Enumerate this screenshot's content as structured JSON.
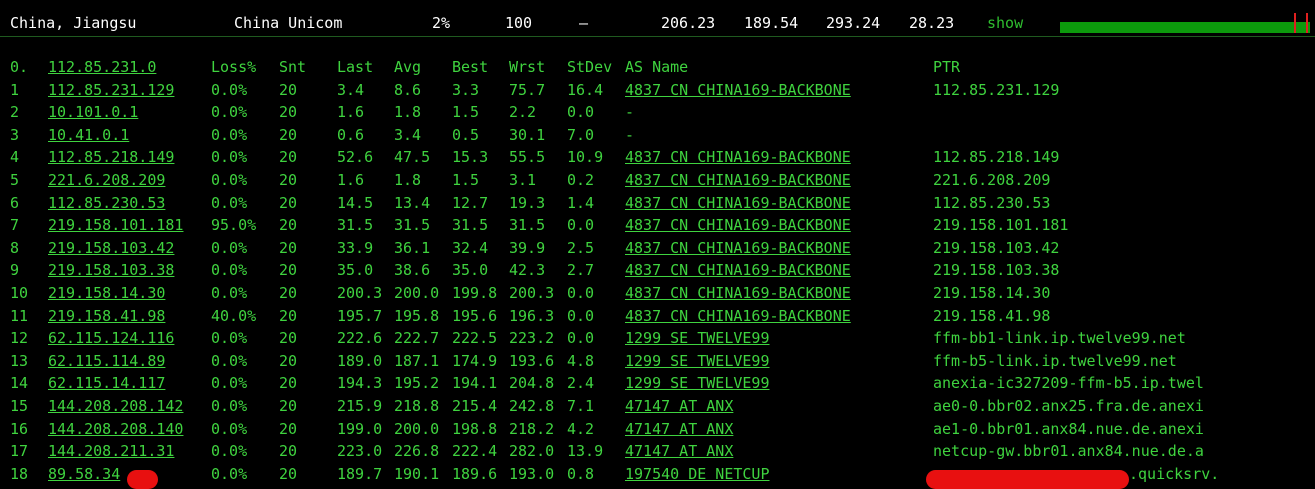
{
  "summary": {
    "location": "China, Jiangsu",
    "isp": "China Unicom",
    "loss": "2%",
    "sent": "100",
    "dash": "–",
    "last": "206.23",
    "best": "189.54",
    "worst": "293.24",
    "stdev": "28.23",
    "show_label": "show",
    "graph_color": "#0c9a0c",
    "graph_marker_color": "#e02020"
  },
  "table": {
    "headers": {
      "no": "0.",
      "host": "112.85.231.0",
      "loss": "Loss%",
      "snt": "Snt",
      "last": "Last",
      "avg": "Avg",
      "best": "Best",
      "wrst": "Wrst",
      "stdev": "StDev",
      "as": "AS Name",
      "ptr": "PTR"
    },
    "rows": [
      {
        "no": "1",
        "host": "112.85.231.129",
        "loss": "0.0%",
        "snt": "20",
        "last": "3.4",
        "avg": "8.6",
        "best": "3.3",
        "wrst": "75.7",
        "stdev": "16.4",
        "as": "4837  CN CHINA169-BACKBONE",
        "ptr": "112.85.231.129"
      },
      {
        "no": "2",
        "host": "10.101.0.1",
        "loss": "0.0%",
        "snt": "20",
        "last": "1.6",
        "avg": "1.8",
        "best": "1.5",
        "wrst": "2.2",
        "stdev": "0.0",
        "as": "-",
        "ptr": ""
      },
      {
        "no": "3",
        "host": "10.41.0.1",
        "loss": "0.0%",
        "snt": "20",
        "last": "0.6",
        "avg": "3.4",
        "best": "0.5",
        "wrst": "30.1",
        "stdev": "7.0",
        "as": "-",
        "ptr": ""
      },
      {
        "no": "4",
        "host": "112.85.218.149",
        "loss": "0.0%",
        "snt": "20",
        "last": "52.6",
        "avg": "47.5",
        "best": "15.3",
        "wrst": "55.5",
        "stdev": "10.9",
        "as": "4837  CN CHINA169-BACKBONE",
        "ptr": "112.85.218.149"
      },
      {
        "no": "5",
        "host": "221.6.208.209",
        "loss": "0.0%",
        "snt": "20",
        "last": "1.6",
        "avg": "1.8",
        "best": "1.5",
        "wrst": "3.1",
        "stdev": "0.2",
        "as": "4837  CN CHINA169-BACKBONE",
        "ptr": "221.6.208.209"
      },
      {
        "no": "6",
        "host": "112.85.230.53",
        "loss": "0.0%",
        "snt": "20",
        "last": "14.5",
        "avg": "13.4",
        "best": "12.7",
        "wrst": "19.3",
        "stdev": "1.4",
        "as": "4837  CN CHINA169-BACKBONE",
        "ptr": "112.85.230.53"
      },
      {
        "no": "7",
        "host": "219.158.101.181",
        "loss": "95.0%",
        "snt": "20",
        "last": "31.5",
        "avg": "31.5",
        "best": "31.5",
        "wrst": "31.5",
        "stdev": "0.0",
        "as": "4837  CN CHINA169-BACKBONE",
        "ptr": "219.158.101.181"
      },
      {
        "no": "8",
        "host": "219.158.103.42",
        "loss": "0.0%",
        "snt": "20",
        "last": "33.9",
        "avg": "36.1",
        "best": "32.4",
        "wrst": "39.9",
        "stdev": "2.5",
        "as": "4837  CN CHINA169-BACKBONE",
        "ptr": "219.158.103.42"
      },
      {
        "no": "9",
        "host": "219.158.103.38",
        "loss": "0.0%",
        "snt": "20",
        "last": "35.0",
        "avg": "38.6",
        "best": "35.0",
        "wrst": "42.3",
        "stdev": "2.7",
        "as": "4837  CN CHINA169-BACKBONE",
        "ptr": "219.158.103.38"
      },
      {
        "no": "10",
        "host": "219.158.14.30",
        "loss": "0.0%",
        "snt": "20",
        "last": "200.3",
        "avg": "200.0",
        "best": "199.8",
        "wrst": "200.3",
        "stdev": "0.0",
        "as": "4837  CN CHINA169-BACKBONE",
        "ptr": "219.158.14.30"
      },
      {
        "no": "11",
        "host": "219.158.41.98",
        "loss": "40.0%",
        "snt": "20",
        "last": "195.7",
        "avg": "195.8",
        "best": "195.6",
        "wrst": "196.3",
        "stdev": "0.0",
        "as": "4837  CN CHINA169-BACKBONE",
        "ptr": "219.158.41.98"
      },
      {
        "no": "12",
        "host": "62.115.124.116",
        "loss": "0.0%",
        "snt": "20",
        "last": "222.6",
        "avg": "222.7",
        "best": "222.5",
        "wrst": "223.2",
        "stdev": "0.0",
        "as": "1299  SE TWELVE99",
        "ptr": "ffm-bb1-link.ip.twelve99.net"
      },
      {
        "no": "13",
        "host": "62.115.114.89",
        "loss": "0.0%",
        "snt": "20",
        "last": "189.0",
        "avg": "187.1",
        "best": "174.9",
        "wrst": "193.6",
        "stdev": "4.8",
        "as": "1299  SE TWELVE99",
        "ptr": "ffm-b5-link.ip.twelve99.net"
      },
      {
        "no": "14",
        "host": "62.115.14.117",
        "loss": "0.0%",
        "snt": "20",
        "last": "194.3",
        "avg": "195.2",
        "best": "194.1",
        "wrst": "204.8",
        "stdev": "2.4",
        "as": "1299  SE TWELVE99",
        "ptr": "anexia-ic327209-ffm-b5.ip.twel"
      },
      {
        "no": "15",
        "host": "144.208.208.142",
        "loss": "0.0%",
        "snt": "20",
        "last": "215.9",
        "avg": "218.8",
        "best": "215.4",
        "wrst": "242.8",
        "stdev": "7.1",
        "as": "47147 AT ANX",
        "ptr": "ae0-0.bbr02.anx25.fra.de.anexi"
      },
      {
        "no": "16",
        "host": "144.208.208.140",
        "loss": "0.0%",
        "snt": "20",
        "last": "199.0",
        "avg": "200.0",
        "best": "198.8",
        "wrst": "218.2",
        "stdev": "4.2",
        "as": "47147 AT ANX",
        "ptr": "ae1-0.bbr01.anx84.nue.de.anexi"
      },
      {
        "no": "17",
        "host": "144.208.211.31",
        "loss": "0.0%",
        "snt": "20",
        "last": "223.0",
        "avg": "226.8",
        "best": "222.4",
        "wrst": "282.0",
        "stdev": "13.9",
        "as": "47147 AT ANX",
        "ptr": "netcup-gw.bbr01.anx84.nue.de.a"
      },
      {
        "no": "18",
        "host": "89.58.34",
        "loss": "0.0%",
        "snt": "20",
        "last": "189.7",
        "avg": "190.1",
        "best": "189.6",
        "wrst": "193.0",
        "stdev": "0.8",
        "as": "197540 DE NETCUP",
        "ptr": ".quicksrv."
      }
    ]
  },
  "colors": {
    "background": "#000000",
    "text_green": "#3fd33f",
    "redaction": "#e81010"
  }
}
